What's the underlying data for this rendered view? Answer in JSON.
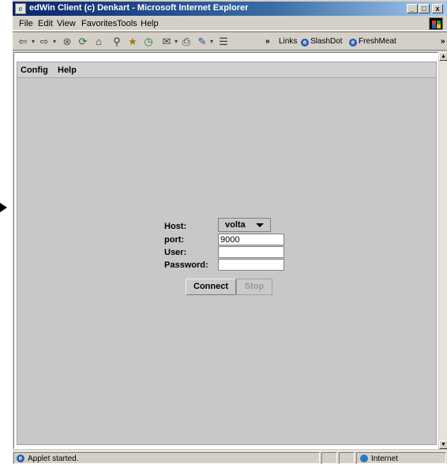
{
  "window": {
    "title": "edWin Client (c) Denkart - Microsoft Internet Explorer",
    "min_label": "_",
    "max_label": "□",
    "close_label": "x"
  },
  "menu": [
    "File",
    "Edit",
    "View",
    "Favorites",
    "Tools",
    "Help"
  ],
  "toolbar": {
    "chevron": "»",
    "links_label": "Links",
    "link_items": [
      "SlashDot",
      "FreshMeat"
    ],
    "overflow": "»"
  },
  "applet": {
    "menu": [
      "Config",
      "Help"
    ],
    "host_label": "Host:",
    "host_value": "volta",
    "port_label": "port:",
    "port_value": "9000",
    "user_label": "User:",
    "user_value": "",
    "password_label": "Password:",
    "password_value": "",
    "connect_label": "Connect",
    "stop_label": "Stop"
  },
  "status": {
    "text": "Applet started.",
    "zone": "Internet"
  },
  "colors": {
    "titlebar_start": "#0a246a",
    "titlebar_end": "#a6caf0",
    "chrome": "#d4d0c8",
    "applet_bg": "#c8c8c8"
  }
}
